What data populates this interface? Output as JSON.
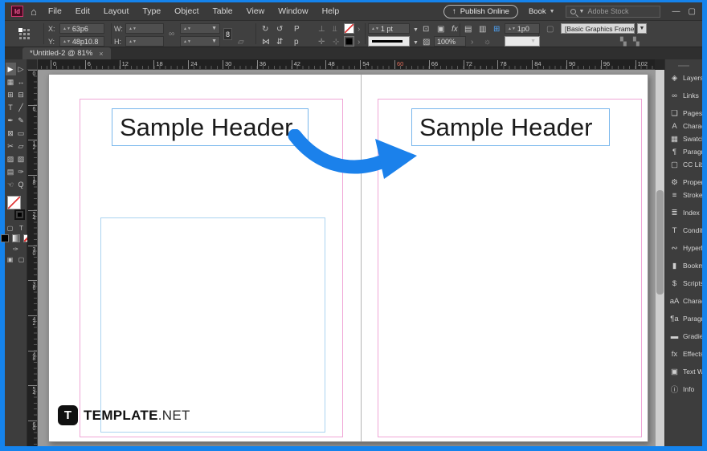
{
  "titlebar": {
    "menus": [
      "File",
      "Edit",
      "Layout",
      "Type",
      "Object",
      "Table",
      "View",
      "Window",
      "Help"
    ],
    "logo_text": "Id",
    "home_glyph": "⌂",
    "publish_label": "Publish Online",
    "publish_icon": "↑",
    "book_label": "Book",
    "search_placeholder": "Adobe Stock",
    "minimize_glyph": "—",
    "restore_glyph": "▢"
  },
  "control_panel": {
    "x_label": "X:",
    "x_value": "63p6",
    "y_label": "Y:",
    "y_value": "48p10.8",
    "w_label": "W:",
    "w_value": "",
    "h_label": "H:",
    "h_value": "",
    "link_glyph": "8",
    "rotate_letter": "P",
    "stroke_weight": "1 pt",
    "opacity_value": "100%",
    "corner_value": "1p0",
    "object_style": "[Basic Graphics Frame]",
    "fx_label": "fx"
  },
  "tab": {
    "title": "*Untitled-2 @ 81%",
    "close_glyph": "×"
  },
  "rulers": {
    "h_ticks": [
      0,
      6,
      12,
      18,
      24,
      30,
      36,
      42,
      48,
      54,
      60,
      66,
      72,
      78,
      84,
      90,
      96,
      102
    ],
    "v_ticks": [
      0,
      6,
      12,
      18,
      24,
      30,
      36,
      42,
      48,
      54,
      60
    ],
    "highlight_tick": 60
  },
  "tools": [
    {
      "name": "selection-tool",
      "glyph": "▶",
      "active": true
    },
    {
      "name": "direct-selection-tool",
      "glyph": "▷"
    },
    {
      "name": "page-tool",
      "glyph": "▦"
    },
    {
      "name": "gap-tool",
      "glyph": "↔"
    },
    {
      "name": "content-collector-tool",
      "glyph": "⊞"
    },
    {
      "name": "content-placer-tool",
      "glyph": "⊟"
    },
    {
      "name": "type-tool",
      "glyph": "T"
    },
    {
      "name": "line-tool",
      "glyph": "╱"
    },
    {
      "name": "pen-tool",
      "glyph": "✒"
    },
    {
      "name": "pencil-tool",
      "glyph": "✎"
    },
    {
      "name": "frame-tool",
      "glyph": "⊠"
    },
    {
      "name": "rectangle-tool",
      "glyph": "▭"
    },
    {
      "name": "scissors-tool",
      "glyph": "✂"
    },
    {
      "name": "free-transform-tool",
      "glyph": "▱"
    },
    {
      "name": "gradient-tool",
      "glyph": "▨"
    },
    {
      "name": "gradient-feather-tool",
      "glyph": "▧"
    },
    {
      "name": "note-tool",
      "glyph": "▤"
    },
    {
      "name": "eyedropper-tool",
      "glyph": "✑"
    },
    {
      "name": "hand-tool",
      "glyph": "☜"
    },
    {
      "name": "zoom-tool",
      "glyph": "Q"
    }
  ],
  "document": {
    "left_page_header": "Sample Header",
    "right_page_header": "Sample Header"
  },
  "watermark": {
    "badge_letter": "T",
    "brand": "TEMPLATE",
    "suffix": ".NET"
  },
  "dock": {
    "items": [
      {
        "label": "Layers",
        "glyph": "◈"
      },
      {
        "label": "Links",
        "glyph": "∞"
      },
      {
        "label": "Pages",
        "glyph": "❏"
      },
      {
        "label": "Charact",
        "glyph": "A",
        "tight": true
      },
      {
        "label": "Swatche",
        "glyph": "▦",
        "tight": true
      },
      {
        "label": "Paragra",
        "glyph": "¶",
        "tight": true
      },
      {
        "label": "CC Libr",
        "glyph": "▢",
        "tight": true
      },
      {
        "label": "Properti",
        "glyph": "⚙"
      },
      {
        "label": "Stroke",
        "glyph": "≡",
        "tight": true
      },
      {
        "label": "Index",
        "glyph": "≣"
      },
      {
        "label": "Conditio",
        "glyph": "T"
      },
      {
        "label": "Hyperli",
        "glyph": "∾"
      },
      {
        "label": "Bookma",
        "glyph": "▮"
      },
      {
        "label": "Scripts",
        "glyph": "$"
      },
      {
        "label": "Charact",
        "glyph": "aA"
      },
      {
        "label": "Paragra",
        "glyph": "¶a"
      },
      {
        "label": "Gradien",
        "glyph": "▬"
      },
      {
        "label": "Effects",
        "glyph": "fx"
      },
      {
        "label": "Text Wr",
        "glyph": "▣"
      },
      {
        "label": "Info",
        "glyph": "ⓘ"
      }
    ]
  },
  "colors": {
    "frame_blue": "#1583ec",
    "arrow_blue": "#1b81eb",
    "margin_guide_pink": "#f0a6d6",
    "frame_edge_blue": "#79b7ec"
  }
}
